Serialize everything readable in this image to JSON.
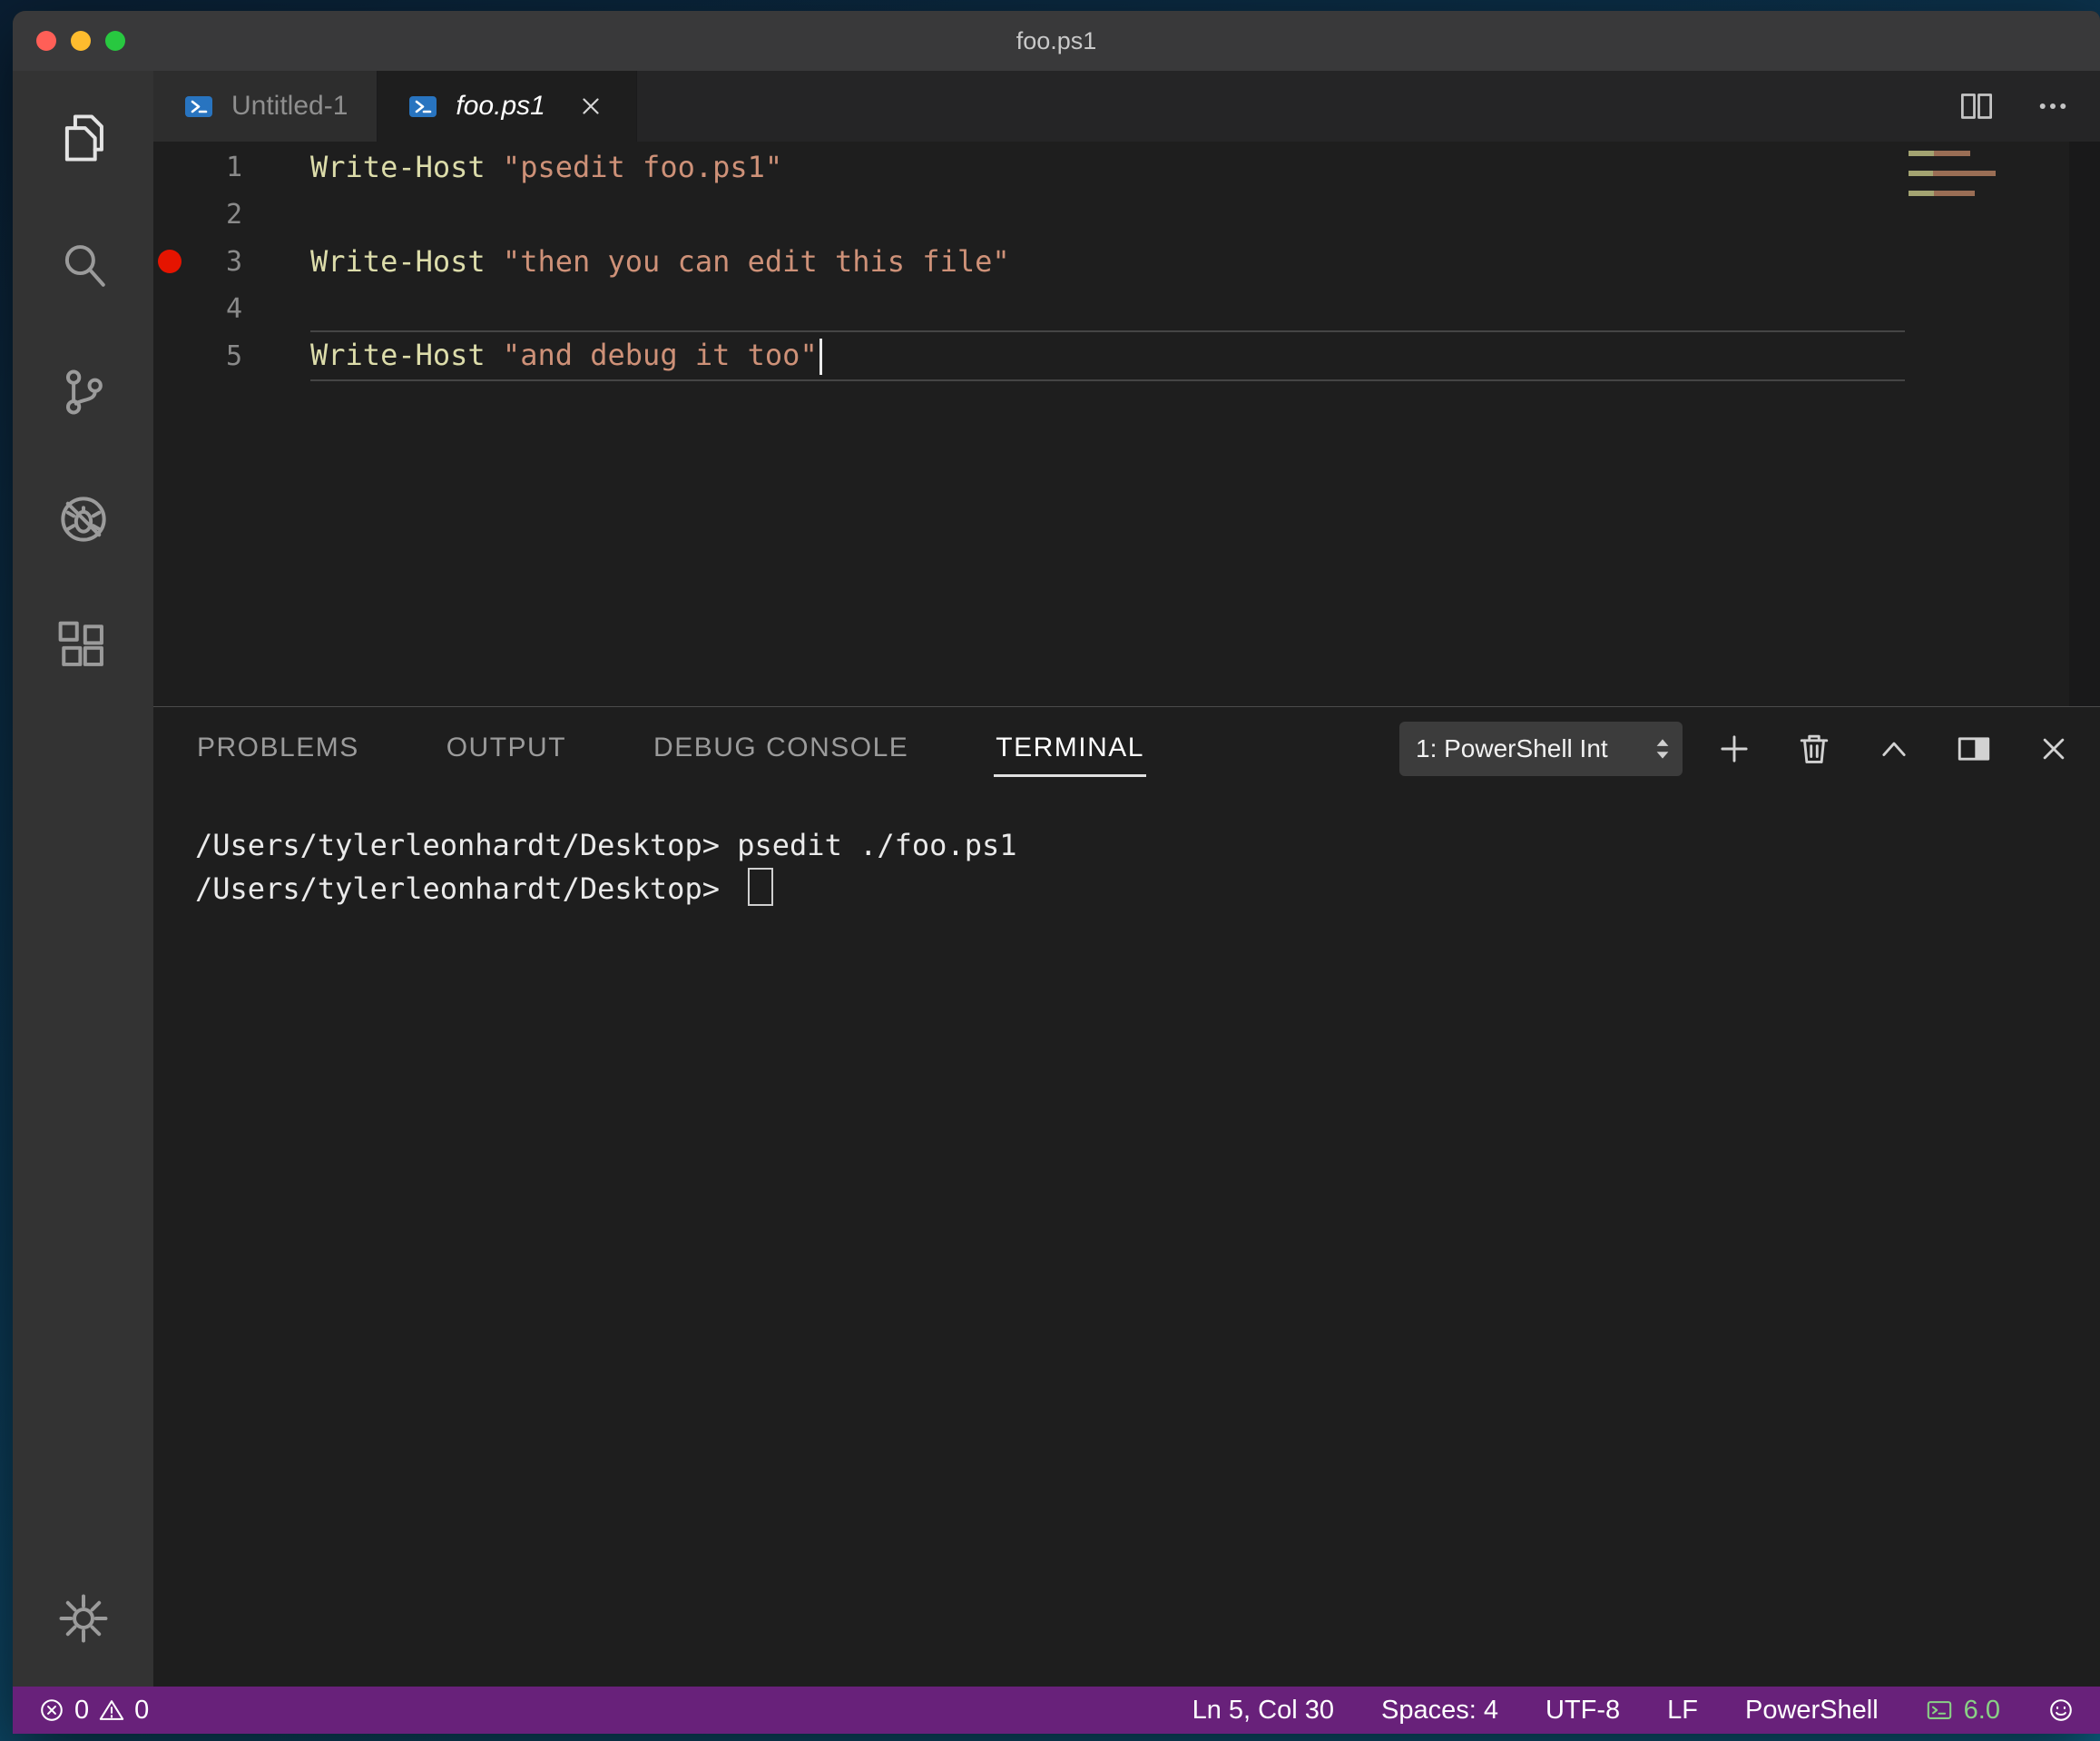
{
  "window": {
    "title": "foo.ps1",
    "traffic_lights": [
      "#ff5f57",
      "#febc2e",
      "#28c840"
    ]
  },
  "activity_bar": {
    "top": [
      {
        "name": "explorer",
        "active": true
      },
      {
        "name": "search"
      },
      {
        "name": "source-control"
      },
      {
        "name": "debug"
      },
      {
        "name": "extensions"
      }
    ],
    "bottom": [
      {
        "name": "settings"
      }
    ]
  },
  "editor_tabs": [
    {
      "label": "Untitled-1",
      "icon": "powershell",
      "active": false,
      "show_close": false
    },
    {
      "label": "foo.ps1",
      "icon": "powershell",
      "active": true,
      "show_close": true
    }
  ],
  "tab_bar_actions": [
    {
      "name": "split-editor",
      "icon": "split-editor"
    },
    {
      "name": "more-actions",
      "icon": "ellipsis"
    }
  ],
  "editor": {
    "token_colors": {
      "cmd": "#dcdcaa",
      "str": "#ce9178"
    },
    "lines": [
      {
        "num": 1,
        "tokens": [
          {
            "t": "cmd",
            "v": "Write-Host "
          },
          {
            "t": "str",
            "v": "\"psedit foo.ps1\""
          }
        ]
      },
      {
        "num": 2,
        "tokens": []
      },
      {
        "num": 3,
        "breakpoint": true,
        "tokens": [
          {
            "t": "cmd",
            "v": "Write-Host "
          },
          {
            "t": "str",
            "v": "\"then you can edit this file\""
          }
        ]
      },
      {
        "num": 4,
        "tokens": []
      },
      {
        "num": 5,
        "current": true,
        "cursor": true,
        "tokens": [
          {
            "t": "cmd",
            "v": "Write-Host "
          },
          {
            "t": "str",
            "v": "\"and debug it too\""
          }
        ]
      }
    ]
  },
  "panel": {
    "tabs": [
      {
        "label": "PROBLEMS"
      },
      {
        "label": "OUTPUT"
      },
      {
        "label": "DEBUG CONSOLE"
      },
      {
        "label": "TERMINAL",
        "active": true
      }
    ],
    "picker": {
      "value": "1: PowerShell Int"
    },
    "actions": [
      {
        "name": "new-terminal",
        "icon": "plus"
      },
      {
        "name": "kill-terminal",
        "icon": "trash"
      },
      {
        "name": "maximize-panel",
        "icon": "chevron-up"
      },
      {
        "name": "split-panel",
        "icon": "split"
      },
      {
        "name": "close-panel",
        "icon": "close"
      }
    ],
    "terminal": {
      "lines": [
        {
          "prompt": "/Users/tylerleonhardt/Desktop>",
          "command": "psedit ./foo.ps1"
        },
        {
          "prompt": "/Users/tylerleonhardt/Desktop>",
          "command": "",
          "cursor": true
        }
      ]
    }
  },
  "status_bar": {
    "accent": "#68217a",
    "errors": "0",
    "warnings": "0",
    "items": [
      {
        "name": "cursor-position",
        "label": "Ln 5, Col 30"
      },
      {
        "name": "indentation",
        "label": "Spaces: 4"
      },
      {
        "name": "encoding",
        "label": "UTF-8"
      },
      {
        "name": "eol",
        "label": "LF"
      },
      {
        "name": "language-mode",
        "label": "PowerShell"
      }
    ],
    "ps_version": "6.0",
    "version_color": "#89d185"
  }
}
